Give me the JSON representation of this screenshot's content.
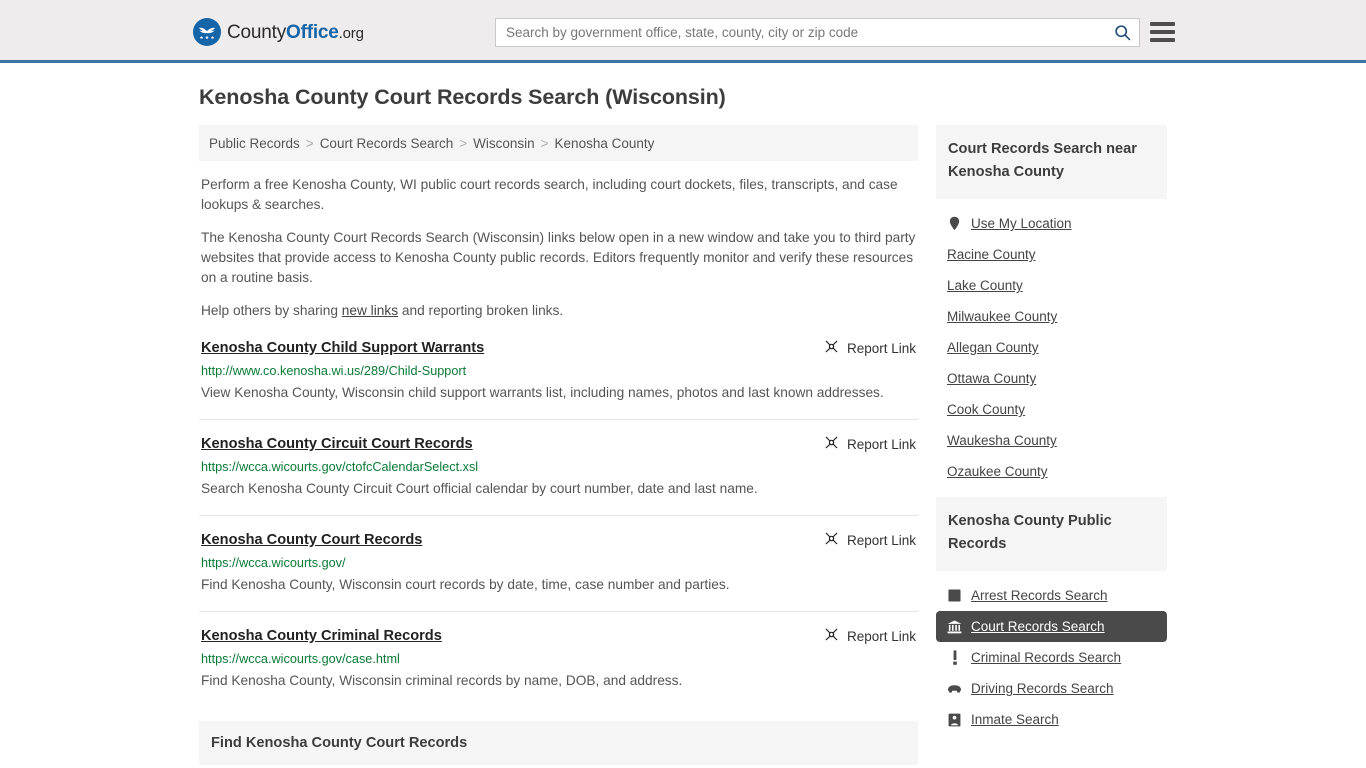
{
  "header": {
    "logo": {
      "part1": "County",
      "part2": "Office",
      "part3": ".org",
      "icon": "eagle-shield-logo"
    },
    "search": {
      "placeholder": "Search by government office, state, county, city or zip code",
      "value": "",
      "icon": "search-icon"
    },
    "menu_icon": "hamburger-menu-icon"
  },
  "page_title": "Kenosha County Court Records Search (Wisconsin)",
  "breadcrumb": {
    "separator": ">",
    "items": [
      {
        "label": "Public Records"
      },
      {
        "label": "Court Records Search"
      },
      {
        "label": "Wisconsin"
      },
      {
        "label": "Kenosha County"
      }
    ]
  },
  "intro": {
    "p1": "Perform a free Kenosha County, WI public court records search, including court dockets, files, transcripts, and case lookups & searches.",
    "p2": "The Kenosha County Court Records Search (Wisconsin) links below open in a new window and take you to third party websites that provide access to Kenosha County public records. Editors frequently monitor and verify these resources on a routine basis.",
    "p3_before": "Help others by sharing ",
    "p3_link": "new links",
    "p3_after": " and reporting broken links."
  },
  "report_link_label": "Report Link",
  "report_link_icon": "broken-link-icon",
  "results": [
    {
      "title": "Kenosha County Child Support Warrants",
      "url": "http://www.co.kenosha.wi.us/289/Child-Support",
      "description": "View Kenosha County, Wisconsin child support warrants list, including names, photos and last known addresses."
    },
    {
      "title": "Kenosha County Circuit Court Records",
      "url": "https://wcca.wicourts.gov/ctofcCalendarSelect.xsl",
      "description": "Search Kenosha County Circuit Court official calendar by court number, date and last name."
    },
    {
      "title": "Kenosha County Court Records",
      "url": "https://wcca.wicourts.gov/",
      "description": "Find Kenosha County, Wisconsin court records by date, time, case number and parties."
    },
    {
      "title": "Kenosha County Criminal Records",
      "url": "https://wcca.wicourts.gov/case.html",
      "description": "Find Kenosha County, Wisconsin criminal records by name, DOB, and address."
    }
  ],
  "find_panel": {
    "title": "Find Kenosha County Court Records"
  },
  "sidebar": {
    "nearby": {
      "title": "Court Records Search near Kenosha County",
      "items": [
        {
          "label": "Use My Location",
          "icon": "map-pin-icon"
        },
        {
          "label": "Racine County",
          "icon": ""
        },
        {
          "label": "Lake County",
          "icon": ""
        },
        {
          "label": "Milwaukee County",
          "icon": ""
        },
        {
          "label": "Allegan County",
          "icon": ""
        },
        {
          "label": "Ottawa County",
          "icon": ""
        },
        {
          "label": "Cook County",
          "icon": ""
        },
        {
          "label": "Waukesha County",
          "icon": ""
        },
        {
          "label": "Ozaukee County",
          "icon": ""
        }
      ]
    },
    "public_records": {
      "title": "Kenosha County Public Records",
      "items": [
        {
          "label": "Arrest Records Search",
          "icon": "fingerprint-icon",
          "active": false
        },
        {
          "label": "Court Records Search",
          "icon": "courthouse-icon",
          "active": true
        },
        {
          "label": "Criminal Records Search",
          "icon": "exclamation-icon",
          "active": false
        },
        {
          "label": "Driving Records Search",
          "icon": "car-icon",
          "active": false
        },
        {
          "label": "Inmate Search",
          "icon": "inmate-icon",
          "active": false
        }
      ]
    }
  },
  "colors": {
    "header_bg": "#eeecec",
    "header_border": "#3d72a4",
    "brand_blue": "#1565a8",
    "url_green": "#0a7a36",
    "panel_gray": "#f5f5f5",
    "active_dark": "#4a4a4a"
  }
}
